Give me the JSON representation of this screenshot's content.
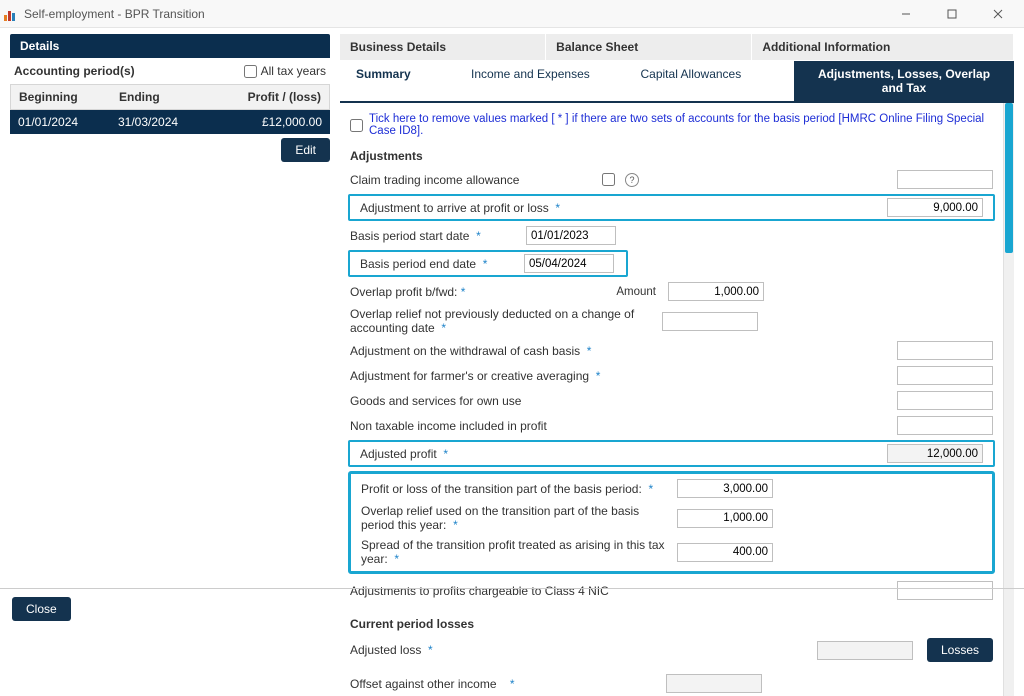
{
  "window": {
    "title": "Self-employment - BPR Transition"
  },
  "left": {
    "detailsHeader": "Details",
    "accountingPeriods": "Accounting period(s)",
    "allTaxYears": "All tax years",
    "cols": {
      "beginning": "Beginning",
      "ending": "Ending",
      "profitLoss": "Profit / (loss)"
    },
    "row": {
      "beginning": "01/01/2024",
      "ending": "31/03/2024",
      "pl": "£12,000.00"
    },
    "editBtn": "Edit"
  },
  "tabsTop": {
    "biz": "Business Details",
    "bal": "Balance Sheet",
    "add": "Additional Information"
  },
  "tabsSub": {
    "summary": "Summary",
    "income": "Income and Expenses",
    "cap": "Capital Allowances",
    "adj": "Adjustments, Losses, Overlap and Tax"
  },
  "tickText": "Tick here to remove values marked [ * ] if there are two sets of accounts for the basis period [HMRC Online Filing Special Case ID8].",
  "sections": {
    "adjustments": "Adjustments",
    "currentLosses": "Current period losses"
  },
  "labels": {
    "claimAllowance": "Claim trading income allowance",
    "adjArrive": "Adjustment to arrive at profit or loss",
    "basisStart": "Basis period start date",
    "basisEnd": "Basis period end date",
    "overlapBfwd": "Overlap profit b/fwd:",
    "amount": "Amount",
    "overlapNotDeducted": "Overlap relief not previously deducted on a change of accounting date",
    "withdrawalCash": "Adjustment on the withdrawal of cash basis",
    "farmers": "Adjustment for farmer's or creative averaging",
    "goods": "Goods and services for own use",
    "nonTaxable": "Non taxable income included in profit",
    "adjustedProfit": "Adjusted profit",
    "transitionPL": "Profit or loss of the transition part of the basis period:",
    "overlapTransition": "Overlap relief used on the transition part of the basis period this year:",
    "spread": "Spread of the transition profit treated as arising in this tax year:",
    "class4": "Adjustments to profits chargeable to Class 4 NIC",
    "adjustedLoss": "Adjusted loss",
    "offset": "Offset against other income"
  },
  "values": {
    "adjArrive": "9,000.00",
    "basisStart": "01/01/2023",
    "basisEnd": "05/04/2024",
    "overlapAmount": "1,000.00",
    "adjustedProfit": "12,000.00",
    "transitionPL": "3,000.00",
    "overlapTransition": "1,000.00",
    "spread": "400.00"
  },
  "buttons": {
    "losses": "Losses",
    "close": "Close"
  }
}
